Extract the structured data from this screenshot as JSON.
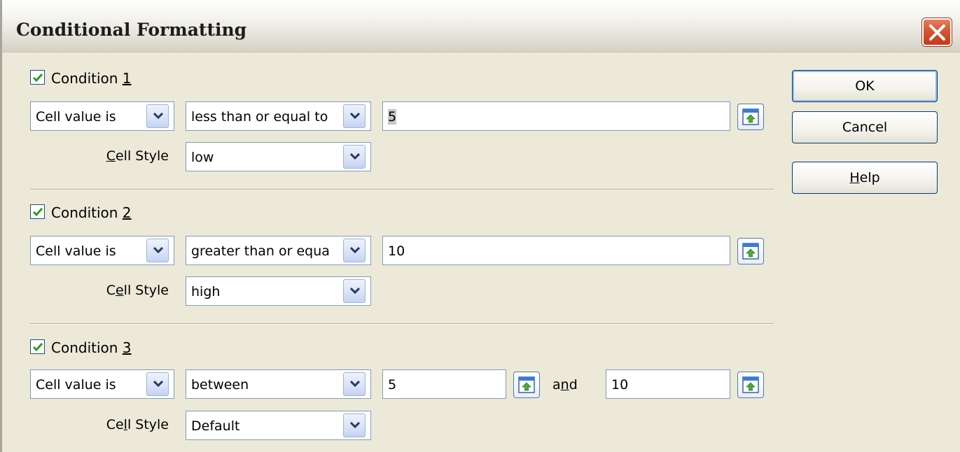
{
  "dialog": {
    "title": "Conditional Formatting"
  },
  "conditions": [
    {
      "label_prefix": "Condition ",
      "label_num": "1",
      "checked": true,
      "operand": "Cell value is",
      "operator": "less than or equal to",
      "value1": "5",
      "style_label_a": "",
      "style_label_u": "C",
      "style_label_b": "ell Style",
      "style": "low"
    },
    {
      "label_prefix": "Condition ",
      "label_num": "2",
      "checked": true,
      "operand": "Cell value is",
      "operator": "greater than or equa",
      "value1": "10",
      "style_label_a": "C",
      "style_label_u": "e",
      "style_label_b": "ll Style",
      "style": "high"
    },
    {
      "label_prefix": "Condition ",
      "label_num": "3",
      "checked": true,
      "operand": "Cell value is",
      "operator": "between",
      "value1": "5",
      "and_a": "a",
      "and_u": "n",
      "and_b": "d",
      "value2": "10",
      "style_label_a": "Ce",
      "style_label_u": "l",
      "style_label_b": "l Style",
      "style": "Default"
    }
  ],
  "buttons": {
    "ok": "OK",
    "cancel": "Cancel",
    "help_u": "H",
    "help_rest": "elp"
  },
  "icons": {
    "checkbox": "checkmark-icon",
    "dropdown": "chevron-down-icon",
    "shrink": "shrink-dialog-icon",
    "close": "close-icon"
  },
  "colors": {
    "dialog_bg": "#ece9d8",
    "close_red": "#d9532f",
    "checkmark_green": "#21a121",
    "field_border": "#7f9db9"
  }
}
